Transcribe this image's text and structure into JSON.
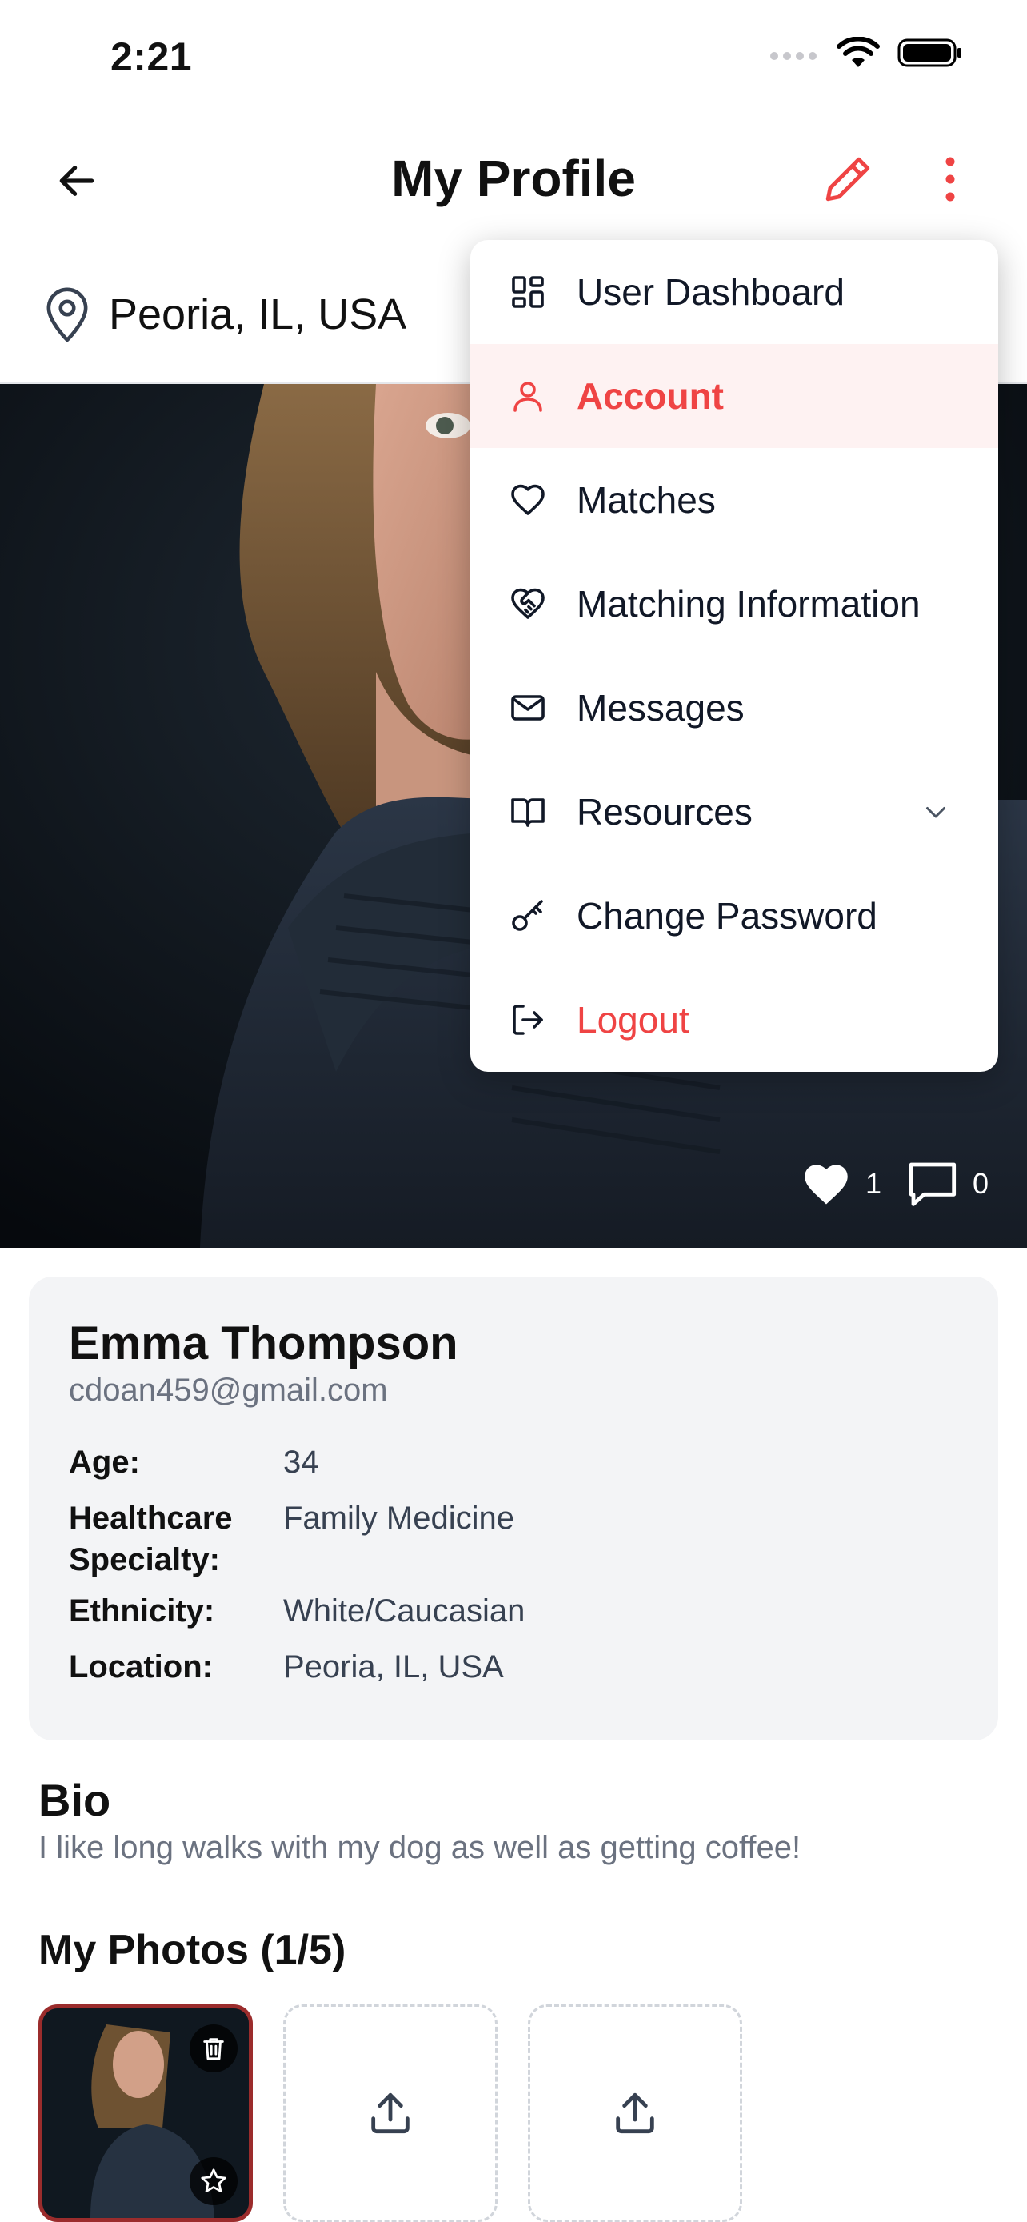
{
  "status_bar": {
    "time": "2:21"
  },
  "header": {
    "title": "My Profile"
  },
  "location": {
    "text": "Peoria, IL, USA"
  },
  "hero": {
    "likes": "1",
    "comments": "0"
  },
  "menu": {
    "items": [
      {
        "label": "User Dashboard",
        "icon": "dashboard-icon"
      },
      {
        "label": "Account",
        "icon": "user-icon",
        "active": true
      },
      {
        "label": "Matches",
        "icon": "heart-icon"
      },
      {
        "label": "Matching Information",
        "icon": "heart-handshake-icon"
      },
      {
        "label": "Messages",
        "icon": "mail-icon"
      },
      {
        "label": "Resources",
        "icon": "book-icon",
        "has_chevron": true
      },
      {
        "label": "Change Password",
        "icon": "key-icon"
      },
      {
        "label": "Logout",
        "icon": "logout-icon",
        "danger": true
      }
    ]
  },
  "profile": {
    "name": "Emma Thompson",
    "email": "cdoan459@gmail.com",
    "rows": [
      {
        "label": "Age:",
        "value": "34"
      },
      {
        "label": "Healthcare Specialty:",
        "value": "Family Medicine"
      },
      {
        "label": "Ethnicity:",
        "value": "White/Caucasian"
      },
      {
        "label": "Location:",
        "value": "Peoria, IL, USA"
      }
    ]
  },
  "bio": {
    "title": "Bio",
    "text": "I like long walks with my dog as well as getting coffee!"
  },
  "photos": {
    "title": "My Photos (1/5)"
  },
  "colors": {
    "accent": "#ef4444",
    "active_bg": "#fef2f2",
    "card_bg": "#f3f4f6",
    "muted_text": "#6b7280"
  }
}
